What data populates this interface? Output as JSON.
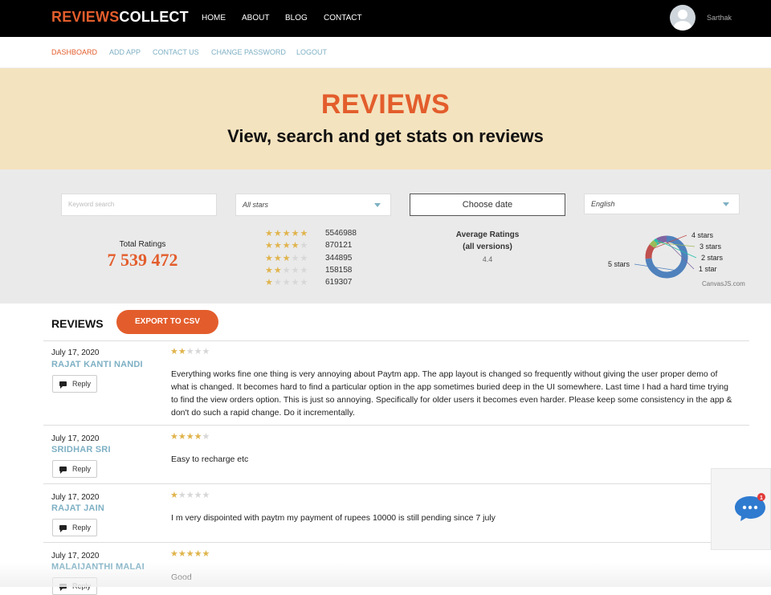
{
  "header": {
    "logo_part1": "REVIEWS",
    "logo_part2": "COLLECT",
    "nav": [
      "HOME",
      "ABOUT",
      "BLOG",
      "CONTACT"
    ],
    "username": "Sarthak"
  },
  "subnav": [
    "DASHBOARD",
    "ADD APP",
    "CONTACT US",
    "CHANGE PASSWORD",
    "LOGOUT"
  ],
  "hero": {
    "title": "REVIEWS",
    "subtitle": "View, search and get stats on reviews"
  },
  "filters": {
    "search_placeholder": "Keyword search",
    "stars_value": "All stars",
    "date_label": "Choose date",
    "language_value": "English"
  },
  "stats": {
    "total_label": "Total Ratings",
    "total_value": "7 539 472",
    "distribution": [
      {
        "stars": 5,
        "count": "5546988"
      },
      {
        "stars": 4,
        "count": "870121"
      },
      {
        "stars": 3,
        "count": "344895"
      },
      {
        "stars": 2,
        "count": "158158"
      },
      {
        "stars": 1,
        "count": "619307"
      }
    ],
    "avg_label_line1": "Average Ratings",
    "avg_label_line2": "(all versions)",
    "avg_value": "4.4"
  },
  "chart_data": {
    "type": "pie",
    "categories": [
      "5 stars",
      "4 stars",
      "3 stars",
      "2 stars",
      "1 star"
    ],
    "values": [
      5546988,
      870121,
      344895,
      158158,
      619307
    ],
    "colors": [
      "#4f81bc",
      "#c0504e",
      "#9bbb58",
      "#23bfaa",
      "#8064a1"
    ],
    "credit": "CanvasJS.com"
  },
  "reviews_section": {
    "title": "REVIEWS",
    "export_label": "EXPORT TO CSV",
    "reply_label": "Reply",
    "items": [
      {
        "date": "July 17, 2020",
        "name": "RAJAT KANTI NANDI",
        "rating": 2,
        "text": "Everything works fine one thing is very annoying about Paytm app. The app layout is changed so frequently without giving the user proper demo of what is changed. It becomes hard to find a particular option in the app sometimes buried deep in the UI somewhere. Last time I had a hard time trying to find the view orders option. This is just so annoying. Specifically for older users it becomes even harder. Please keep some consistency in the app & don't do such a rapid change. Do it incrementally."
      },
      {
        "date": "July 17, 2020",
        "name": "SRIDHAR SRI",
        "rating": 4,
        "text": "Easy to recharge etc"
      },
      {
        "date": "July 17, 2020",
        "name": "RAJAT JAIN",
        "rating": 1,
        "text": "I m very dispointed with paytm my payment of rupees 10000 is still pending since 7 july"
      },
      {
        "date": "July 17, 2020",
        "name": "MALAIJANTHI MALAI",
        "rating": 5,
        "text": "Good"
      }
    ]
  },
  "chat": {
    "badge": "1"
  }
}
